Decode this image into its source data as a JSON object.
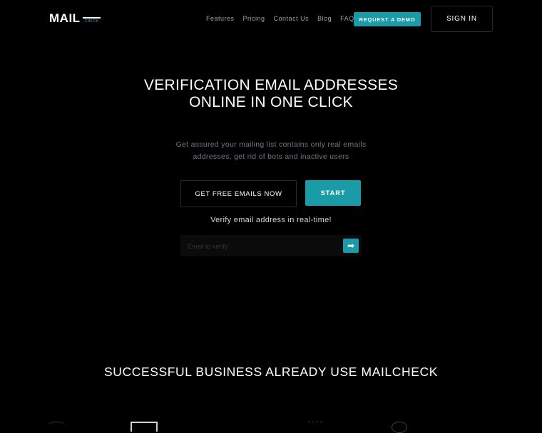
{
  "nav": {
    "logo_main": "MAIL",
    "logo_sub": "CHECK",
    "links": [
      "Features",
      "Pricing",
      "Contact Us",
      "Blog",
      "FAQ"
    ],
    "demo_label": "REQUEST A DEMO",
    "signin_label": "SIGN IN"
  },
  "hero": {
    "title": "VERIFICATION EMAIL ADDRESSES ONLINE IN ONE CLICK",
    "subtitle": "Get assured your mailing list contains only real emails addresses, get rid of bots and inactive users",
    "free_button": "GET FREE EMAILS NOW",
    "start_button": "START",
    "verify_label": "Verify email address in real-time!",
    "verify_placeholder": "Email to verify",
    "go_icon": "arrow-right-icon"
  },
  "partners": {
    "title": "SUCCESSFUL BUSINESS ALREADY USE MAILCHECK",
    "logos": [
      "partner-logo-1",
      "partner-logo-2",
      "partner-logo-3",
      "partner-logo-4"
    ]
  },
  "colors": {
    "accent": "#1a9ba8",
    "background": "#000000"
  }
}
